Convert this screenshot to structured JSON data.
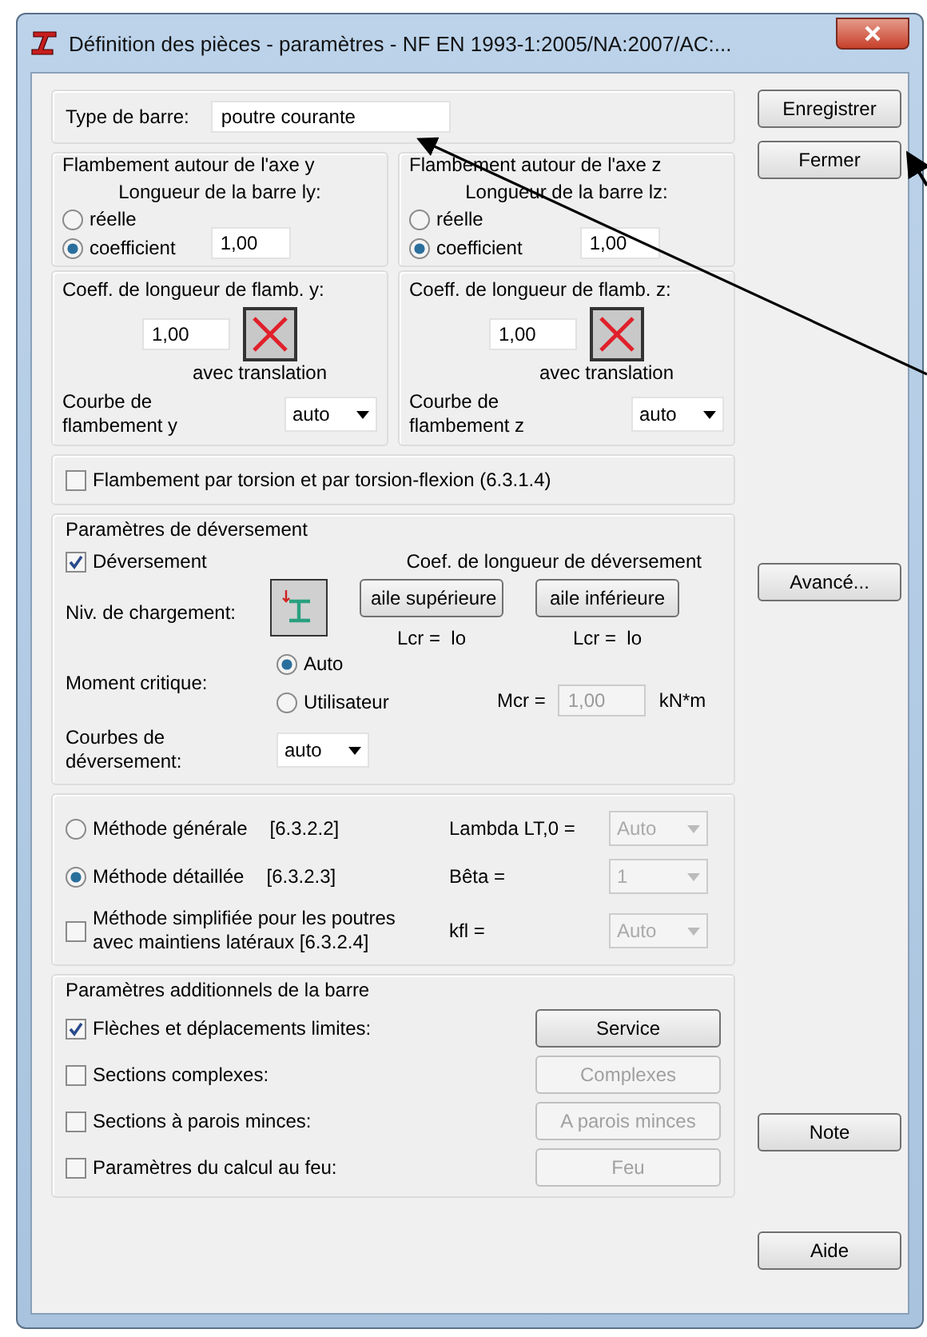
{
  "window": {
    "title": "Définition des pièces - paramètres - NF EN 1993-1:2005/NA:2007/AC:..."
  },
  "bar_type": {
    "label": "Type de barre:",
    "value": "poutre courante"
  },
  "buckling": [
    {
      "title": "Flambement autour de l'axe y",
      "length_label": "Longueur de la barre ly:",
      "options": [
        {
          "label": "réelle",
          "selected": false
        },
        {
          "label": "coefficient",
          "selected": true
        }
      ],
      "length_value": "1,00",
      "coeff_label": "Coeff. de longueur de flamb. y:",
      "coeff_value": "1,00",
      "translation_label": "avec translation",
      "curve_label": "Courbe de flambement  y",
      "curve_value": "auto"
    },
    {
      "title": "Flambement autour de l'axe z",
      "length_label": "Longueur de la barre lz:",
      "options": [
        {
          "label": "réelle",
          "selected": false
        },
        {
          "label": "coefficient",
          "selected": true
        }
      ],
      "length_value": "1,00",
      "coeff_label": "Coeff. de longueur de flamb. z:",
      "coeff_value": "1,00",
      "translation_label": "avec translation",
      "curve_label": "Courbe de flambement  z",
      "curve_value": "auto"
    }
  ],
  "torsion": {
    "label": "Flambement par torsion et par torsion-flexion (6.3.1.4)",
    "checked": false
  },
  "lateral": {
    "title": "Paramètres de déversement",
    "checkbox": {
      "label": "Déversement",
      "checked": true
    },
    "coef_label": "Coef. de longueur de déversement",
    "load_label": "Niv. de chargement:",
    "flanges": [
      {
        "label": "aile supérieure",
        "lcr": "Lcr =  lo"
      },
      {
        "label": "aile inférieure",
        "lcr": "Lcr =  lo"
      }
    ],
    "moment_label": "Moment critique:",
    "moment_options": [
      {
        "label": "Auto",
        "selected": true
      },
      {
        "label": "Utilisateur",
        "selected": false
      }
    ],
    "mcr_label": "Mcr =",
    "mcr_value": "1,00",
    "mcr_disabled": true,
    "mcr_unit": "kN*m",
    "curves_label": "Courbes de déversement:",
    "curves_value": "auto"
  },
  "methods": [
    {
      "kind": "radio",
      "label": "Méthode générale",
      "ref": "[6.3.2.2]",
      "selected": false,
      "param_label": "Lambda LT,0 =",
      "param_value": "Auto",
      "param_disabled": true
    },
    {
      "kind": "radio",
      "label": "Méthode détaillée",
      "ref": "[6.3.2.3]",
      "selected": true,
      "param_label": "Bêta =",
      "param_value": "1",
      "param_disabled": true
    },
    {
      "kind": "checkbox",
      "label": "Méthode simplifiée pour les poutres avec maintiens latéraux [6.3.2.4]",
      "checked": false,
      "param_label": "kfl =",
      "param_value": "Auto",
      "param_disabled": true
    }
  ],
  "additional": {
    "title": "Paramètres additionnels de la barre",
    "items": [
      {
        "label": "Flèches et déplacements limites:",
        "checked": true,
        "button": "Service",
        "button_disabled": false
      },
      {
        "label": "Sections complexes:",
        "checked": false,
        "button": "Complexes",
        "button_disabled": true
      },
      {
        "label": "Sections à parois minces:",
        "checked": false,
        "button": "A parois minces",
        "button_disabled": true
      },
      {
        "label": "Paramètres du calcul au feu:",
        "checked": false,
        "button": "Feu",
        "button_disabled": true
      }
    ]
  },
  "side_buttons": {
    "top": [
      "Enregistrer",
      "Fermer"
    ],
    "lateral": [
      "Avancé..."
    ],
    "additional": [
      "Note",
      "Aide"
    ]
  }
}
